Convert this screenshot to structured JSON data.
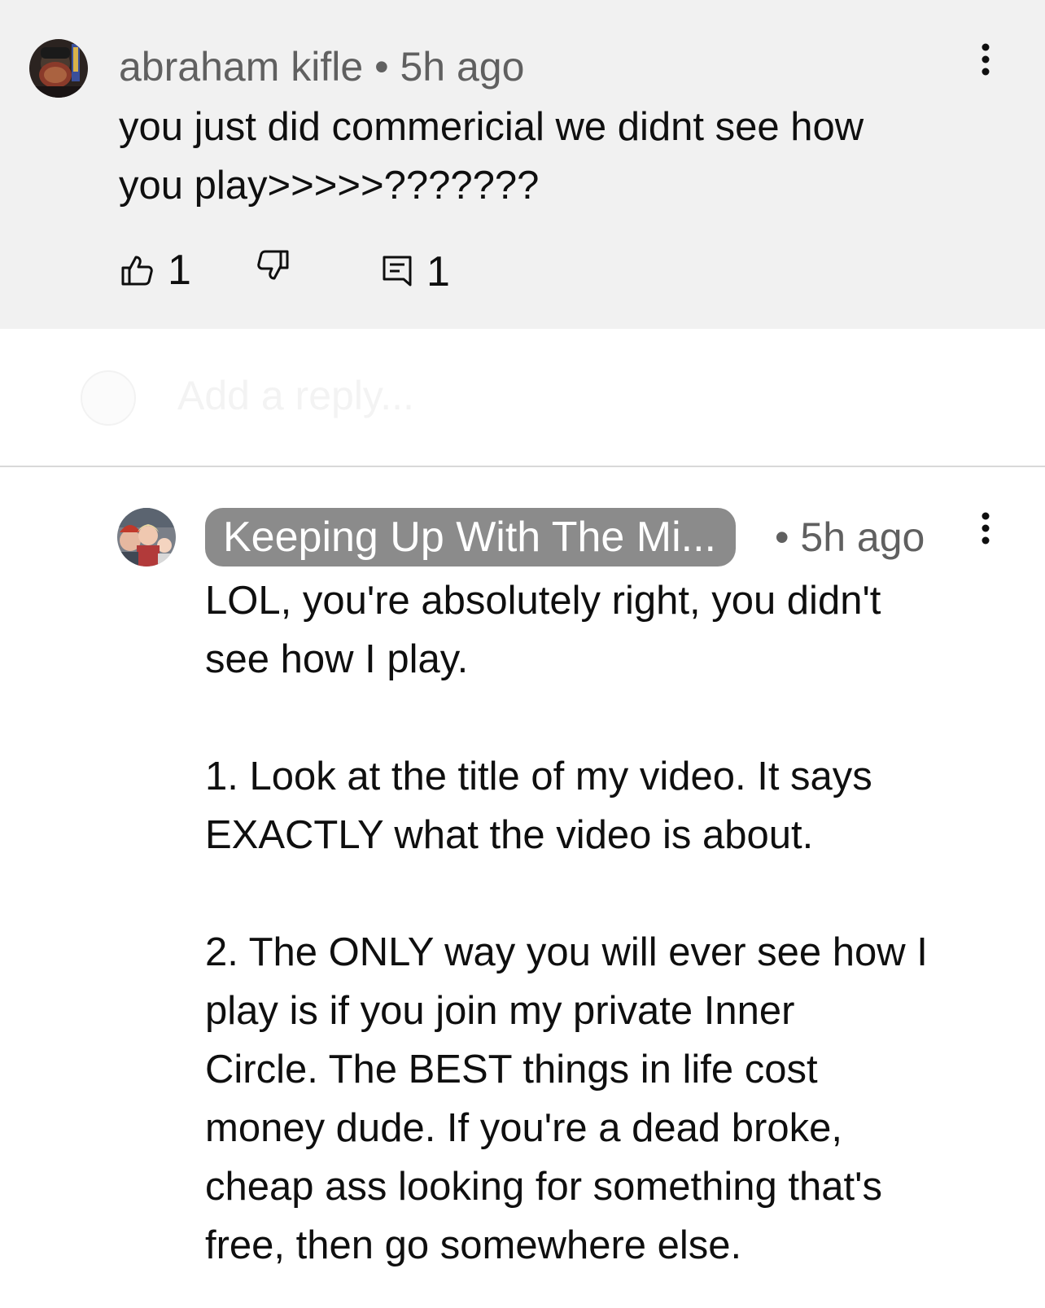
{
  "comment": {
    "author": "abraham kifle",
    "separator": "•",
    "time": "5h ago",
    "text": "you just did commericial we didnt see how\nyou play>>>>>???????",
    "like_count": "1",
    "reply_count": "1"
  },
  "reply_box": {
    "placeholder": "Add a reply..."
  },
  "reply": {
    "channel": "Keeping Up With The Mi...",
    "time": "• 5h ago",
    "text": "LOL, you're absolutely right, you didn't\nsee how I play.\n\n1. Look at the title of my video. It says\nEXACTLY what the video is about.\n\n2. The ONLY way you will ever see how I\nplay is if you join my private Inner\nCircle. The BEST things in life cost\nmoney dude. If you're a dead broke,\ncheap ass looking for something that's\nfree, then go somewhere else."
  },
  "icons": {
    "like": "thumbs-up-icon",
    "dislike": "thumbs-down-icon",
    "reply": "comment-icon",
    "more": "more-vert-icon"
  }
}
